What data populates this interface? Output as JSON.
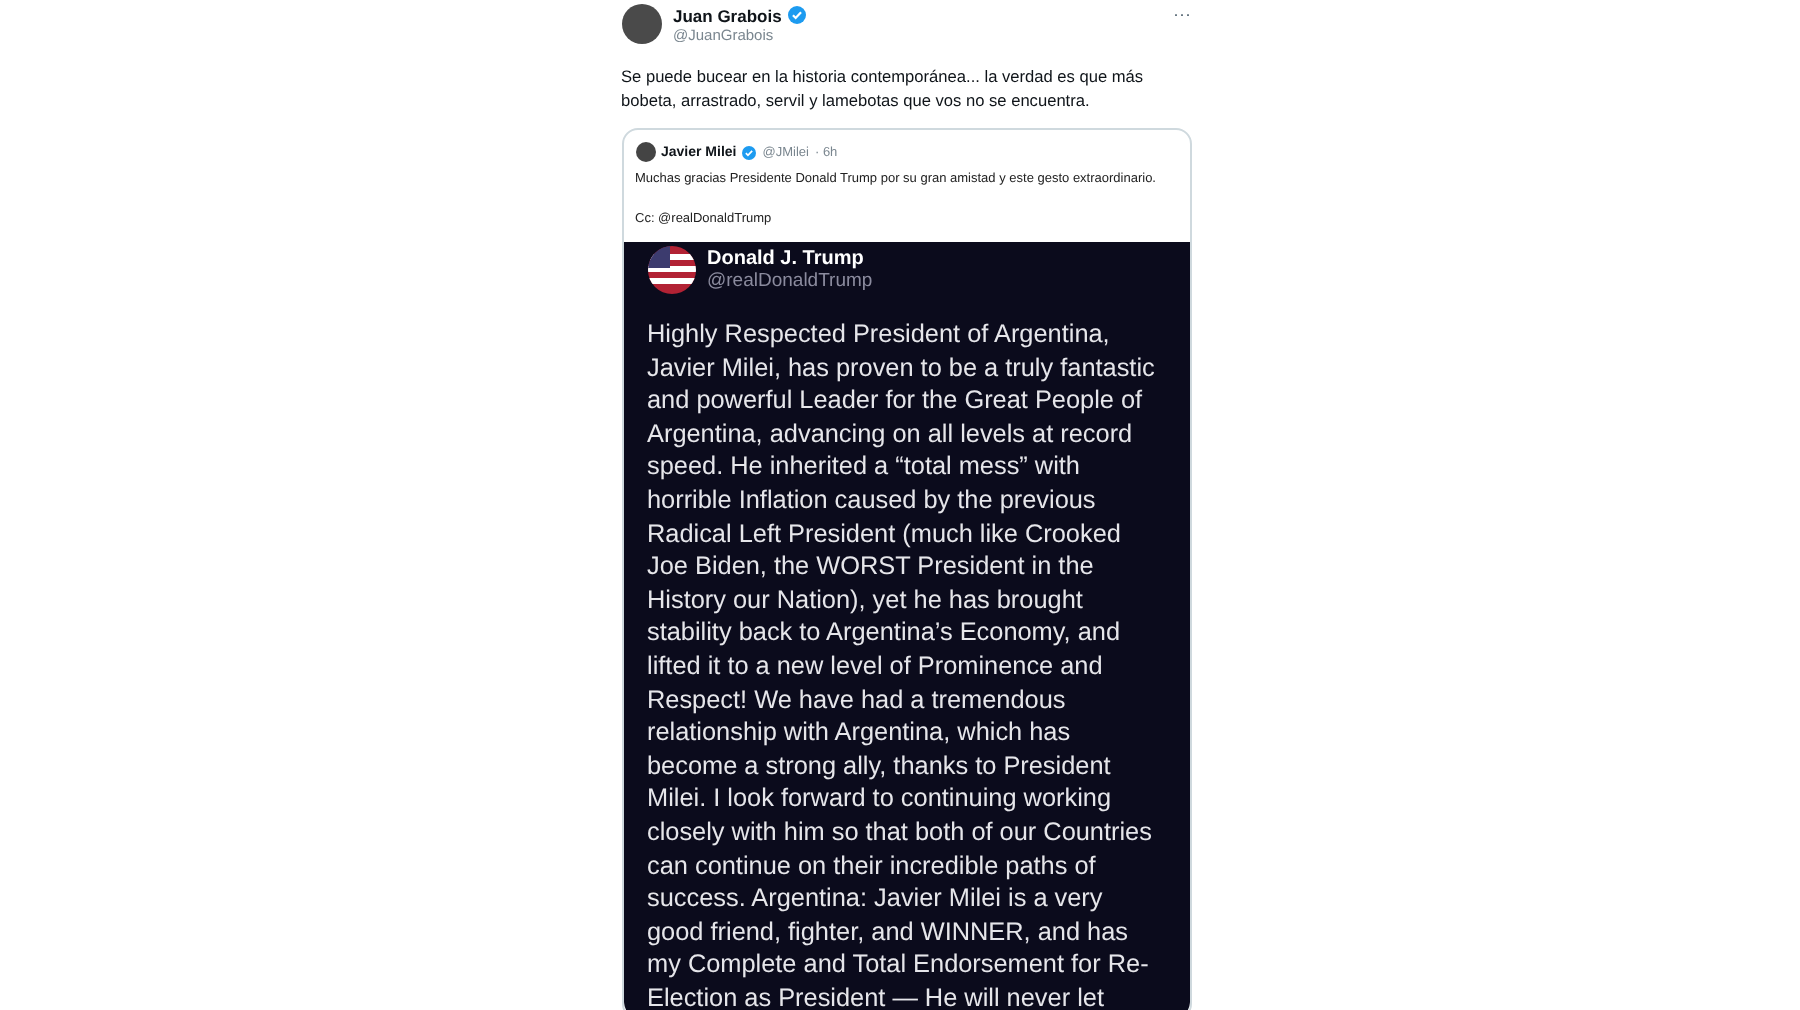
{
  "tweet": {
    "author": {
      "name": "Juan Grabois",
      "handle": "@JuanGrabois",
      "verified": true
    },
    "more": "···",
    "text": "Se puede bucear en la historia contemporánea... la verdad es que más bobeta, arrastrado, servil y lamebotas que vos no se encuentra.",
    "quote": {
      "author": {
        "name": "Javier Milei",
        "handle": "@JMilei",
        "verified": true
      },
      "time": "· 6h",
      "text": "Muchas gracias Presidente Donald Trump por su gran amistad y este gesto extraordinario.",
      "cc": "Cc: @realDonaldTrump",
      "image": {
        "name": "Donald J. Trump",
        "handle": "@realDonaldTrump",
        "text": "Highly Respected President of Argentina, Javier Milei, has proven to be a truly fantastic and powerful Leader for the Great People of Argentina, advancing on all levels at record speed. He inherited a “total mess” with horrible Inflation caused by the previous Radical Left President (much like Crooked Joe Biden, the WORST President in the History our Nation), yet he has brought stability back to Argentina’s Economy, and lifted it to a new level of Prominence and Respect! We have had a tremendous relationship with Argentina, which has become a strong ally, thanks to President Milei. I look forward to continuing working closely with him so that both of our Countries can continue on their incredible paths of success. Argentina: Javier Milei is a very good friend, fighter, and WINNER, and has my Complete and Total Endorsement for Re-Election as President — He will never let"
      }
    }
  }
}
